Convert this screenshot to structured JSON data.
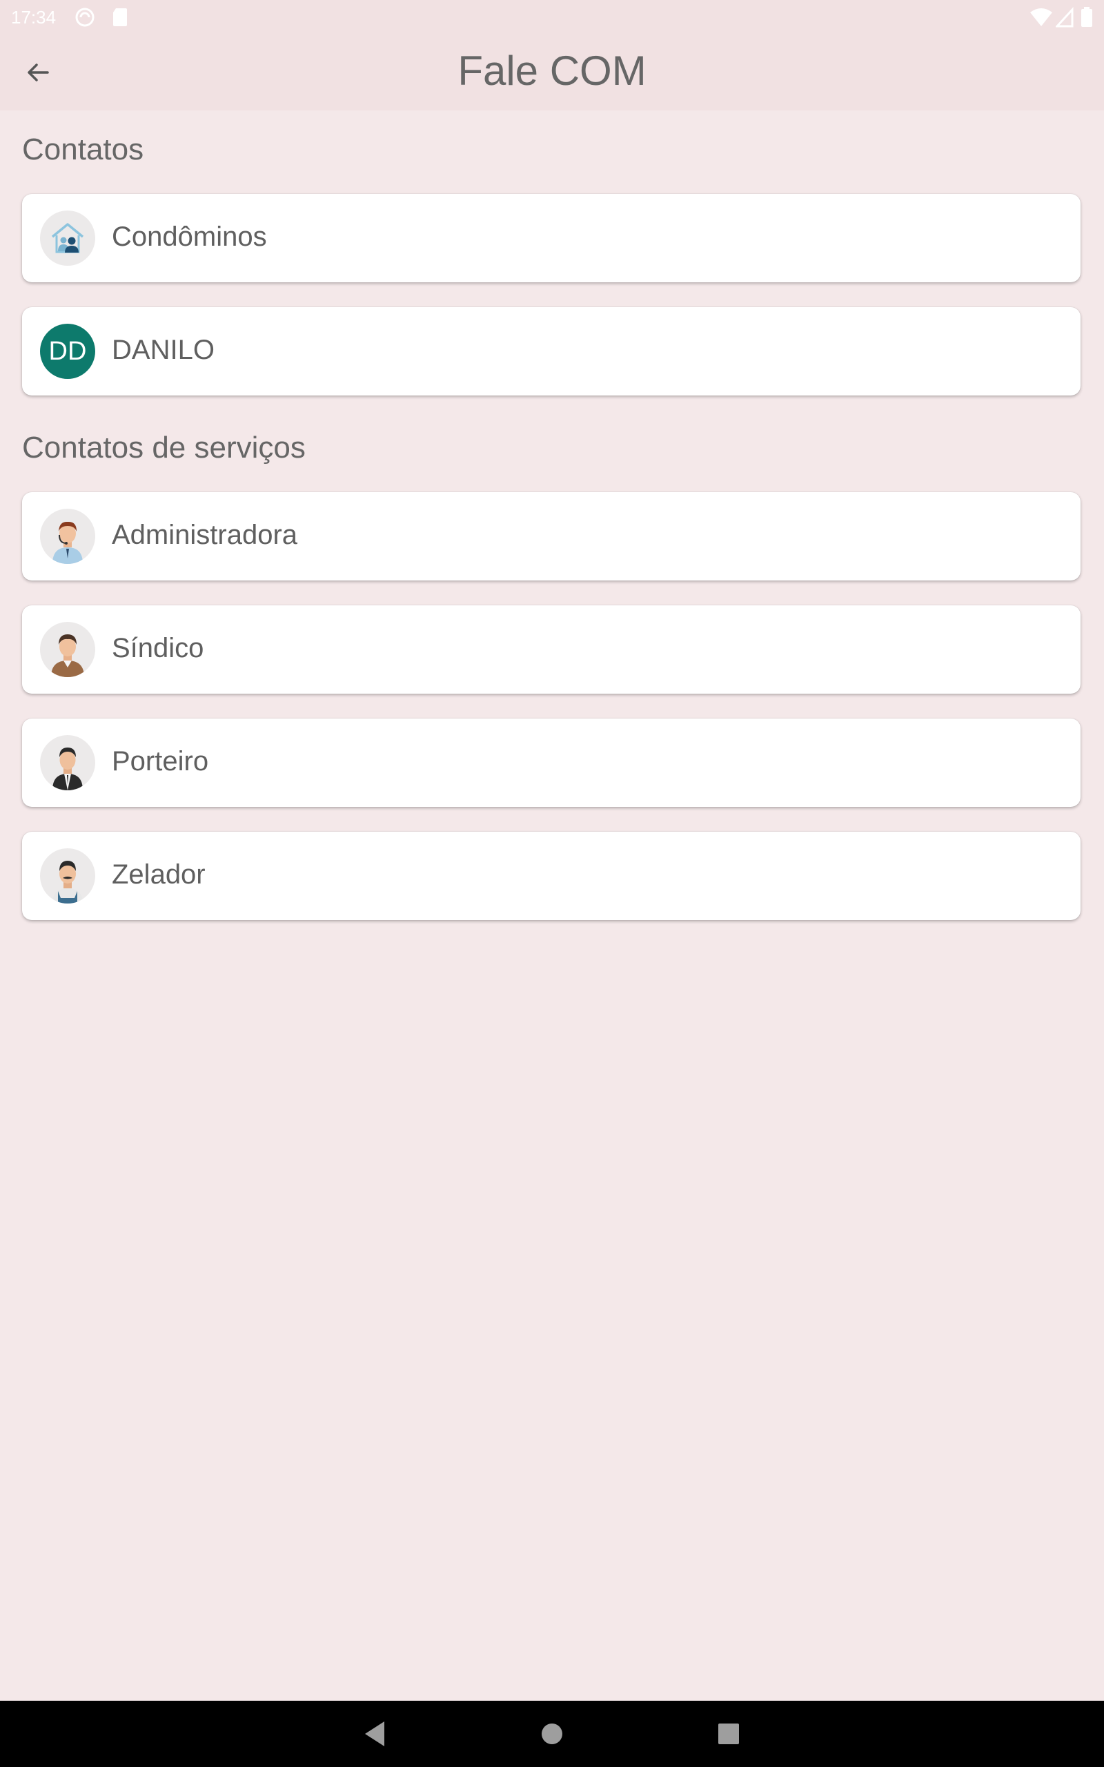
{
  "status": {
    "time": "17:34",
    "icons": [
      "sync-icon",
      "sd-card-icon",
      "wifi-icon",
      "signal-icon",
      "battery-icon"
    ]
  },
  "app_bar": {
    "title": "Fale COM",
    "back_icon": "arrow-left-icon"
  },
  "sections": {
    "contacts": {
      "title": "Contatos",
      "items": [
        {
          "label": "Condôminos",
          "icon": "residents-house-icon"
        },
        {
          "label": "DANILO",
          "initials": "DD",
          "color": "#0d7a6c"
        }
      ]
    },
    "services": {
      "title": "Contatos de serviços",
      "items": [
        {
          "label": "Administradora",
          "icon": "administrator-avatar-icon"
        },
        {
          "label": "Síndico",
          "icon": "manager-avatar-icon"
        },
        {
          "label": "Porteiro",
          "icon": "doorman-avatar-icon"
        },
        {
          "label": "Zelador",
          "icon": "caretaker-avatar-icon"
        }
      ]
    }
  },
  "nav": {
    "icons": [
      "back-triangle-icon",
      "home-circle-icon",
      "recents-square-icon"
    ]
  },
  "colors": {
    "background": "#f4e8e9",
    "app_bar": "#f1e1e2",
    "accent": "#0d7a6c"
  }
}
